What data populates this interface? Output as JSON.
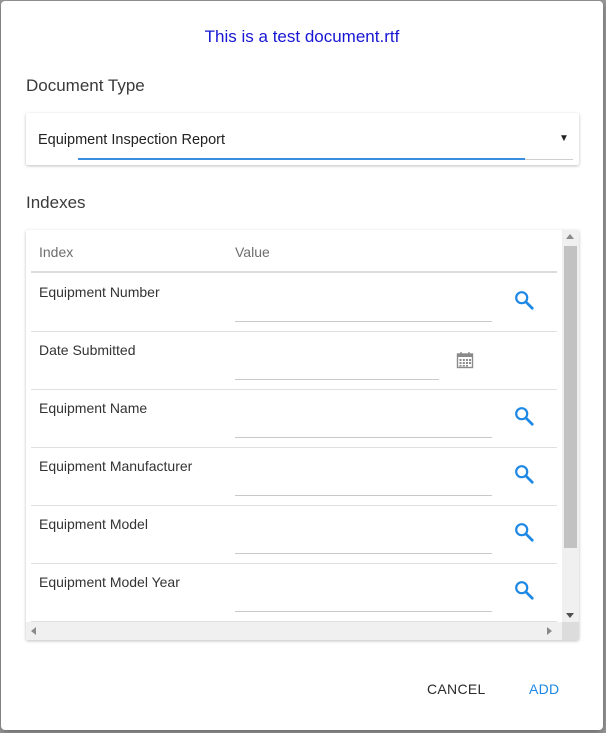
{
  "dialog": {
    "title": "This is a test document.rtf",
    "title_color": "#1616d4"
  },
  "document_type": {
    "label": "Document Type",
    "selected": "Equipment Inspection Report"
  },
  "indexes": {
    "label": "Indexes",
    "columns": [
      "Index",
      "Value"
    ],
    "rows": [
      {
        "label": "Equipment Number",
        "value": "",
        "action_icon": "search-icon"
      },
      {
        "label": "Date Submitted",
        "value": "",
        "action_icon": "calendar-icon"
      },
      {
        "label": "Equipment Name",
        "value": "",
        "action_icon": "search-icon"
      },
      {
        "label": "Equipment Manufacturer",
        "value": "",
        "action_icon": "search-icon"
      },
      {
        "label": "Equipment Model",
        "value": "",
        "action_icon": "search-icon"
      },
      {
        "label": "Equipment Model Year",
        "value": "",
        "action_icon": "search-icon"
      }
    ]
  },
  "actions": {
    "cancel_label": "CANCEL",
    "add_label": "ADD",
    "accent_color": "#1e88e5"
  }
}
